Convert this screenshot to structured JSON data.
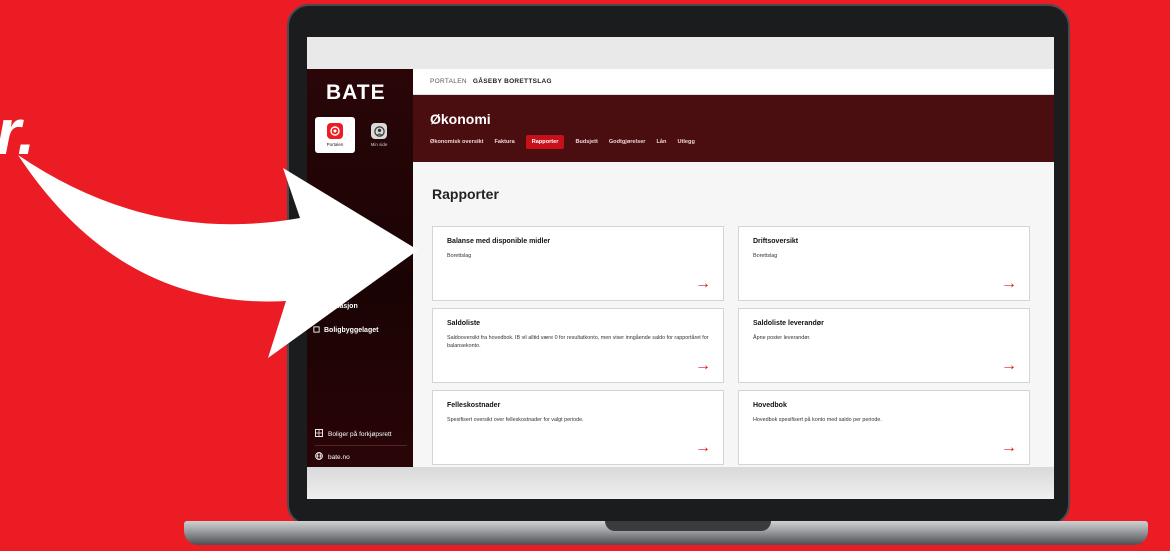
{
  "background": {
    "text_fragment": "r.",
    "accent_color": "#ec1c24"
  },
  "app": {
    "brand": "BATE",
    "sidebar": {
      "tiles": [
        {
          "label": "Portalen",
          "icon": "portal-icon",
          "active": true
        },
        {
          "label": "Min side",
          "icon": "user-icon",
          "active": false
        }
      ],
      "nav_items": [
        {
          "label": "...munikasjon",
          "icon": "chat-icon"
        },
        {
          "label": "Boligbyggelaget",
          "icon": "building-icon"
        }
      ],
      "bottom_links": [
        {
          "label": "Boliger på forkjøpsrett",
          "icon": "grid-icon"
        },
        {
          "label": "bate.no",
          "icon": "globe-icon"
        }
      ]
    },
    "breadcrumb": {
      "root": "PORTALEN",
      "current": "GÅSEBY BORETTSLAG"
    },
    "header": {
      "title": "Økonomi",
      "tabs": [
        {
          "label": "Økonomisk oversikt",
          "active": false
        },
        {
          "label": "Faktura",
          "active": false
        },
        {
          "label": "Rapporter",
          "active": true
        },
        {
          "label": "Budsjett",
          "active": false
        },
        {
          "label": "Godtgjørelser",
          "active": false
        },
        {
          "label": "Lån",
          "active": false
        },
        {
          "label": "Utlegg",
          "active": false
        }
      ]
    },
    "page_title": "Rapporter",
    "cards": [
      {
        "title": "Balanse med disponible midler",
        "description": "Borettslag"
      },
      {
        "title": "Driftsoversikt",
        "description": "Borettslag"
      },
      {
        "title": "Saldoliste",
        "description": "Saldooversikt fra hovedbok. IB vil alltid være 0 for resultatkonto, men viser inngående saldo for rapportåret for balansekonto."
      },
      {
        "title": "Saldoliste leverandør",
        "description": "Åpne poster leverandør."
      },
      {
        "title": "Felleskostnader",
        "description": "Spesifisert oversikt over felleskostnader for valgt periode."
      },
      {
        "title": "Hovedbok",
        "description": "Hovedbok spesifisert på konto med saldo per periode."
      }
    ],
    "card_arrow": "→"
  }
}
